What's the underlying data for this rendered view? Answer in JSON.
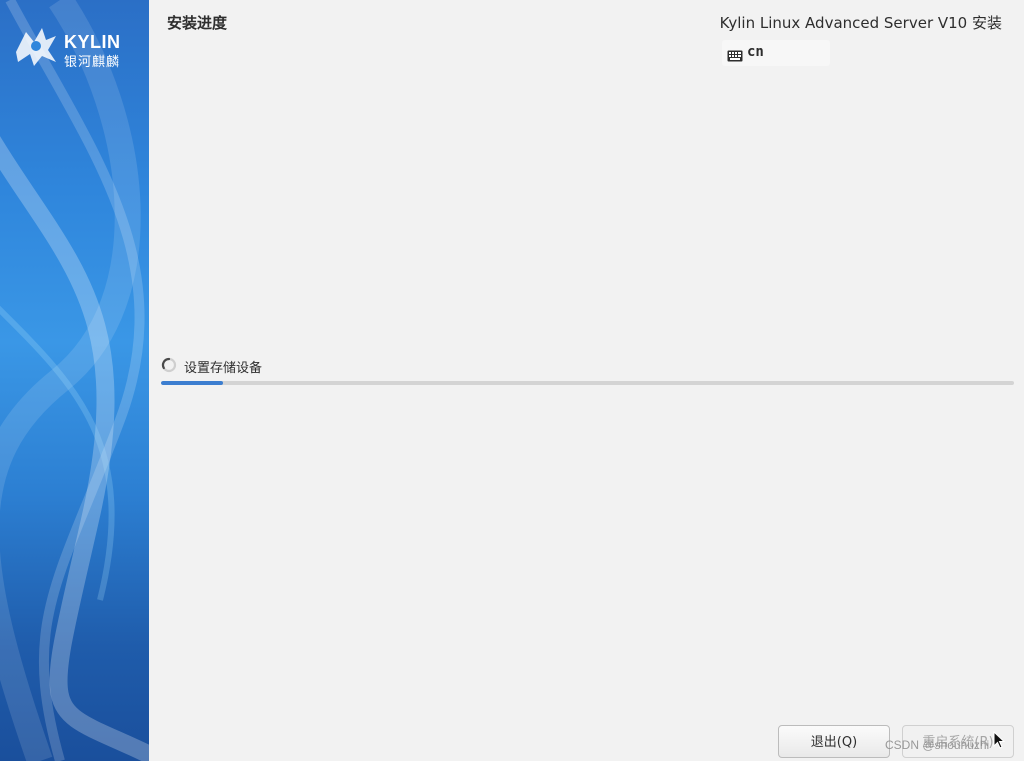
{
  "sidebar": {
    "logo": {
      "brand": "KYLIN",
      "cn": "银河麒麟"
    }
  },
  "header": {
    "page_title": "安装进度",
    "product_title": "Kylin Linux Advanced Server V10 安装",
    "keyboard_layout": "cn"
  },
  "progress": {
    "status_text": "设置存储设备",
    "fraction": 0.073
  },
  "footer": {
    "quit_label": "退出(Q)",
    "reboot_label": "重启系统(R)",
    "reboot_enabled": false
  },
  "watermark": "CSDN @shouhuzhi",
  "colors": {
    "sidebar_blue": "#2f86dc",
    "progress_fill": "#3c7ed0",
    "background": "#f2f2f2"
  },
  "icons": {
    "keyboard": "keyboard-icon",
    "spinner": "spinner-icon",
    "cursor": "mouse-cursor-icon"
  }
}
